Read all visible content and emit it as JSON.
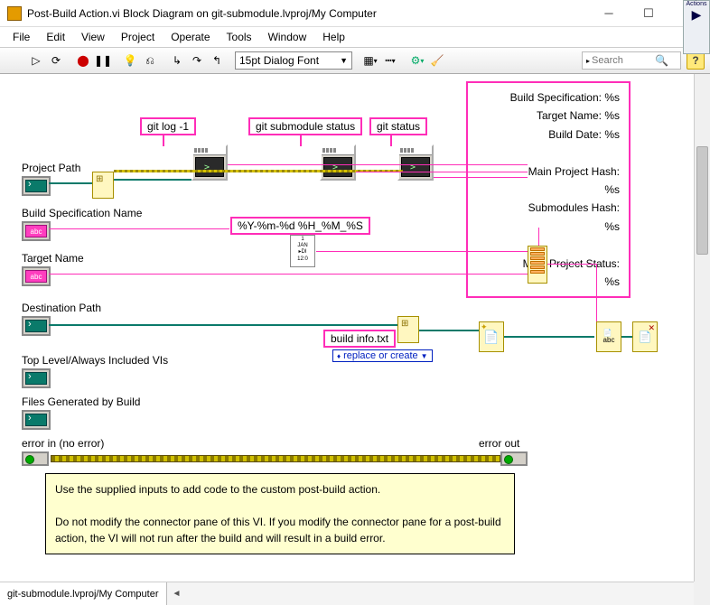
{
  "title": "Post-Build Action.vi Block Diagram on git-submodule.lvproj/My Computer",
  "menu": [
    "File",
    "Edit",
    "View",
    "Project",
    "Operate",
    "Tools",
    "Window",
    "Help"
  ],
  "toolbar": {
    "font": "15pt Dialog Font",
    "search_placeholder": "Search",
    "actions_label": "Actions"
  },
  "labels": {
    "project_path": "Project Path",
    "build_spec": "Build Specification Name",
    "target_name": "Target Name",
    "dest_path": "Destination Path",
    "top_vis": "Top Level/Always Included VIs",
    "files_gen": "Files Generated by Build",
    "error_in": "error in (no error)",
    "error_out": "error out"
  },
  "constants": {
    "git_log": "git log -1",
    "git_submodule": "git submodule status",
    "git_status": "git status",
    "date_fmt": "%Y-%m-%d %H_%M_%S",
    "build_info": "build info.txt",
    "replace": "replace or create"
  },
  "format_text": "Build Specification: %s\nTarget Name: %s\nBuild Date: %s\n\nMain Project Hash:\n%s\nSubmodules Hash:\n%s\n\nMain Project Status:\n%s",
  "note": {
    "l1": "Use the supplied inputs to add code to the custom post-build action.",
    "l2": "Do not modify the connector pane of this VI.  If you modify the connector pane for a post-build action, the VI will not run after the build and will result in a build error."
  },
  "status": "git-submodule.lvproj/My Computer",
  "chart_data": null
}
